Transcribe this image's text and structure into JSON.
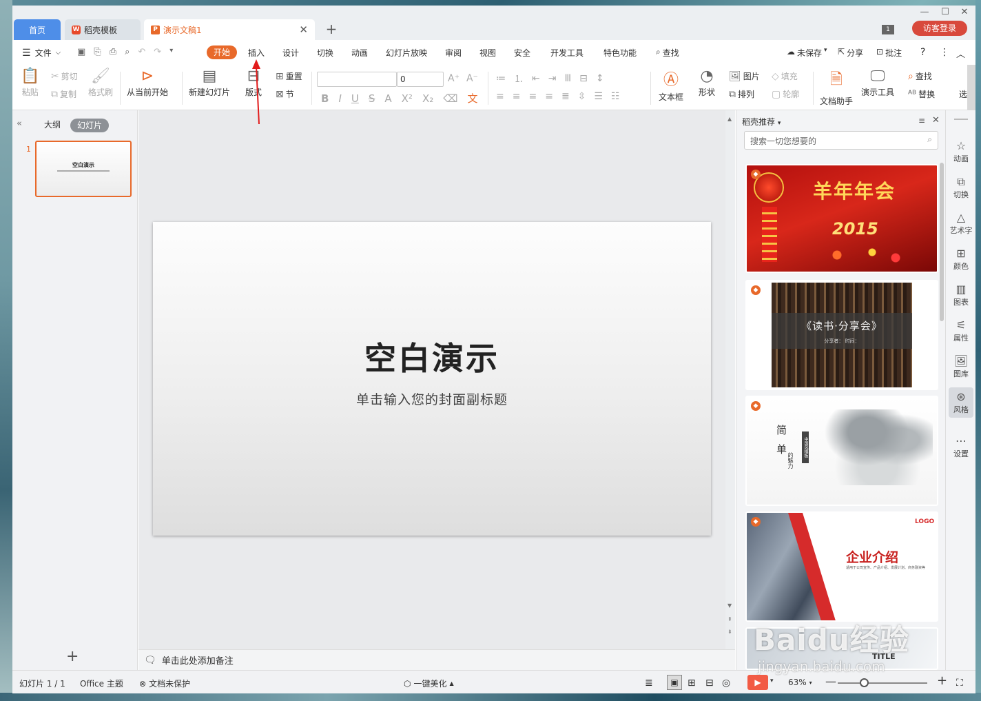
{
  "tabs": {
    "home": "首页",
    "template": "稻壳模板",
    "doc": "演示文稿1",
    "add": "+"
  },
  "window": {
    "badge": "1",
    "login": "访客登录"
  },
  "menu": {
    "file": "文件",
    "items": [
      "开始",
      "插入",
      "设计",
      "切换",
      "动画",
      "幻灯片放映",
      "审阅",
      "视图",
      "安全",
      "开发工具",
      "特色功能"
    ],
    "search": "查找",
    "unsaved": "未保存",
    "share": "分享",
    "comment": "批注",
    "help": "?"
  },
  "ribbon": {
    "paste": "粘贴",
    "cut": "剪切",
    "copy": "复制",
    "format_painter": "格式刷",
    "from_current": "从当前开始",
    "new_slide": "新建幻灯片",
    "layout": "版式",
    "reset": "重置",
    "section": "节",
    "font_size": "0",
    "textbox": "文本框",
    "shape": "形状",
    "picture": "图片",
    "fill": "填充",
    "arrange": "排列",
    "outline": "轮廓",
    "doc_helper": "文档助手",
    "present_tools": "演示工具",
    "find": "查找",
    "replace": "替换",
    "more": "选"
  },
  "left_pane": {
    "outline_tab": "大纲",
    "slides_tab": "幻灯片",
    "slide_number": "1",
    "thumb_title": "空白演示",
    "add": "+"
  },
  "slide": {
    "title": "空白演示",
    "subtitle": "单击输入您的封面副标题"
  },
  "notes": {
    "placeholder": "单击此处添加备注"
  },
  "right_pane": {
    "header": "稻壳推荐",
    "search_placeholder": "搜索一切您想要的",
    "templates": [
      {
        "title": "羊年年会",
        "year": "2015"
      },
      {
        "title": "《读书·分享会》",
        "line": "分享者： 时间："
      },
      {
        "title": "简 单",
        "tail": "的魅力",
        "vertical": "中国风模板"
      },
      {
        "title": "企业介绍",
        "logo": "LOGO",
        "desc": "适用于公司宣传、产品介绍、发展计划、商务融资等"
      },
      {
        "title": "TITLE"
      }
    ]
  },
  "sidebar": {
    "items": [
      "动画",
      "切换",
      "艺术字",
      "颜色",
      "图表",
      "属性",
      "图库",
      "风格",
      "设置"
    ]
  },
  "status": {
    "slide_info": "幻灯片 1 / 1",
    "theme": "Office 主题",
    "protect": "文档未保护",
    "beautify": "一键美化",
    "zoom": "63%",
    "zoom_value": 0.63
  },
  "watermark": {
    "brand": "Baidu经验",
    "url": "jingyan.baidu.com"
  },
  "colors": {
    "accent": "#e8692a",
    "tab_blue": "#4e8ee8",
    "login": "#d8493c",
    "play": "#f25b45"
  }
}
